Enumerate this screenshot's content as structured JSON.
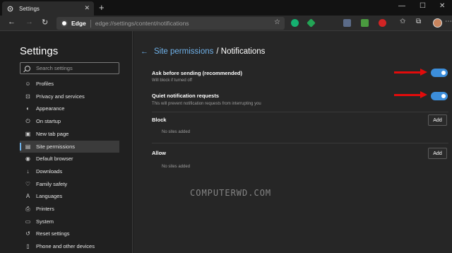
{
  "browser": {
    "tab_title": "Settings",
    "brand": "Edge",
    "url": "edge://settings/content/notifications",
    "new_tab_symbol": "+",
    "window_controls": [
      "—",
      "☐",
      "✕"
    ]
  },
  "sidebar": {
    "title": "Settings",
    "search_placeholder": "Search settings",
    "items": [
      {
        "label": "Profiles",
        "icon": "person-icon"
      },
      {
        "label": "Privacy and services",
        "icon": "lock-icon"
      },
      {
        "label": "Appearance",
        "icon": "appearance-icon"
      },
      {
        "label": "On startup",
        "icon": "power-icon"
      },
      {
        "label": "New tab page",
        "icon": "new-tab-icon"
      },
      {
        "label": "Site permissions",
        "icon": "site-permissions-icon",
        "active": true
      },
      {
        "label": "Default browser",
        "icon": "browser-icon"
      },
      {
        "label": "Downloads",
        "icon": "download-icon"
      },
      {
        "label": "Family safety",
        "icon": "family-icon"
      },
      {
        "label": "Languages",
        "icon": "language-icon"
      },
      {
        "label": "Printers",
        "icon": "printer-icon"
      },
      {
        "label": "System",
        "icon": "system-icon"
      },
      {
        "label": "Reset settings",
        "icon": "reset-icon"
      },
      {
        "label": "Phone and other devices",
        "icon": "phone-icon"
      }
    ]
  },
  "main": {
    "breadcrumb_link": "Site permissions",
    "breadcrumb_rest": "/ Notifications",
    "settings": [
      {
        "title": "Ask before sending (recommended)",
        "subtitle": "Will block if turned off",
        "enabled": true
      },
      {
        "title": "Quiet notification requests",
        "subtitle": "This will prevent notification requests from interrupting you",
        "enabled": true
      }
    ],
    "sections": [
      {
        "title": "Block",
        "empty_text": "No sites added",
        "button": "Add"
      },
      {
        "title": "Allow",
        "empty_text": "No sites added",
        "button": "Add"
      }
    ]
  },
  "watermark": "COMPUTERWD.COM",
  "colors": {
    "accent": "#3c8edb",
    "link": "#6fb1e9",
    "annotation_arrow": "#e20b0b"
  }
}
